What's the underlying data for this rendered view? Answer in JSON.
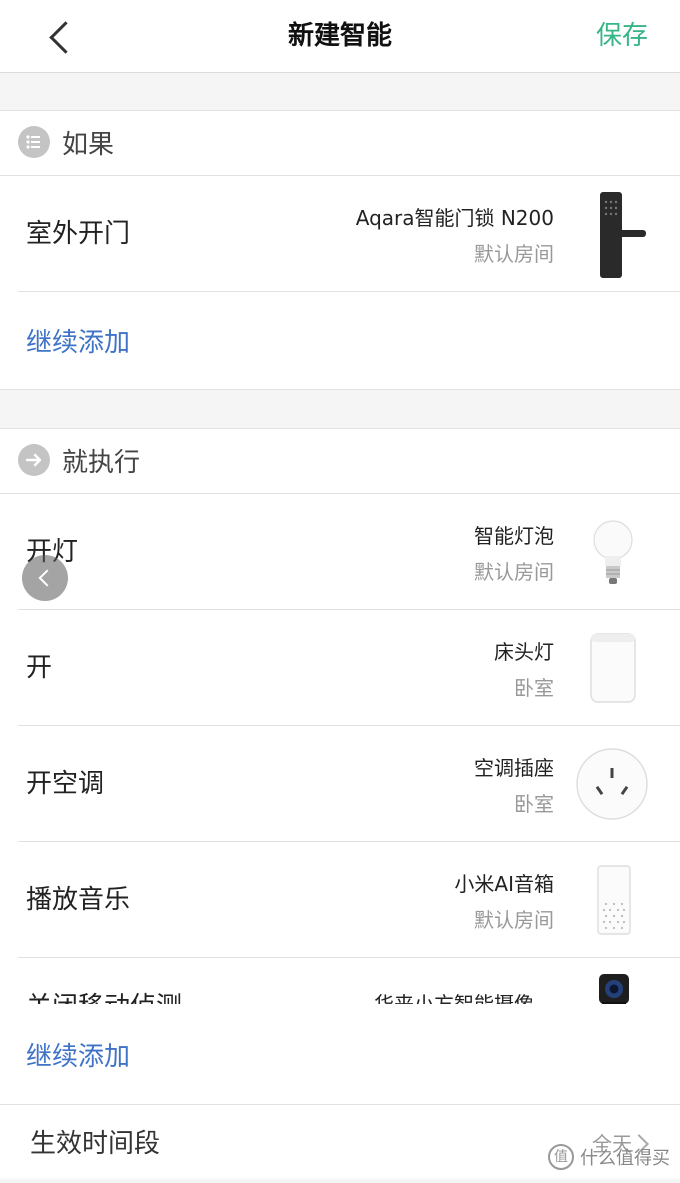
{
  "header": {
    "title": "新建智能",
    "save_label": "保存"
  },
  "if_section": {
    "title": "如果",
    "items": [
      {
        "action": "室外开门",
        "device": "Aqara智能门锁 N200",
        "room": "默认房间",
        "icon": "door-lock-icon"
      }
    ],
    "add_label": "继续添加"
  },
  "then_section": {
    "title": "就执行",
    "items": [
      {
        "action": "开灯",
        "device": "智能灯泡",
        "room": "默认房间",
        "icon": "light-bulb-icon"
      },
      {
        "action": "开",
        "device": "床头灯",
        "room": "卧室",
        "icon": "bedside-lamp-icon"
      },
      {
        "action": "开空调",
        "device": "空调插座",
        "room": "卧室",
        "icon": "smart-plug-icon"
      },
      {
        "action": "播放音乐",
        "device": "小米AI音箱",
        "room": "默认房间",
        "icon": "speaker-icon"
      },
      {
        "action": "关闭移动侦测",
        "device": "华来小方智能摄像",
        "room": "",
        "icon": "camera-icon"
      }
    ],
    "add_label": "继续添加"
  },
  "time_period": {
    "label": "生效时间段",
    "value": "全天"
  },
  "watermark": {
    "text": "什么值得买",
    "logo": "值"
  },
  "colors": {
    "accent": "#37b587",
    "link": "#3f73c7"
  }
}
